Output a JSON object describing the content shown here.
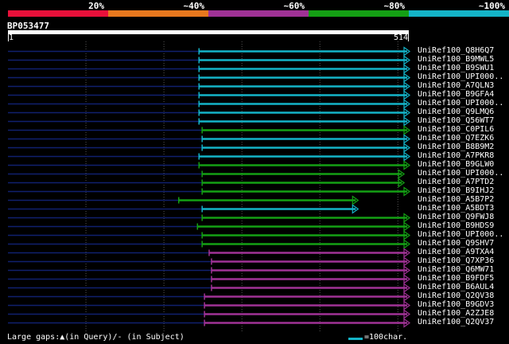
{
  "query": {
    "id": "BP053477",
    "start_label": "1",
    "end_label": "514",
    "length": 514
  },
  "identity_legend": [
    {
      "label": "20%",
      "color": "#e8103a"
    },
    {
      "label": "~40%",
      "color": "#e8781e"
    },
    {
      "label": "~60%",
      "color": "#a03296"
    },
    {
      "label": "~80%",
      "color": "#14a014"
    },
    {
      "label": "~100%",
      "color": "#14b4c8"
    }
  ],
  "hits": [
    {
      "label": "UniRef100_Q8H6Q7",
      "start": 245,
      "end": 514,
      "color": "#14b4c8"
    },
    {
      "label": "UniRef100_B9MWL5",
      "start": 245,
      "end": 514,
      "color": "#14b4c8"
    },
    {
      "label": "UniRef100_B9SWU1",
      "start": 245,
      "end": 514,
      "color": "#14b4c8"
    },
    {
      "label": "UniRef100_UPI000..",
      "start": 245,
      "end": 514,
      "color": "#14b4c8"
    },
    {
      "label": "UniRef100_A7QLN3",
      "start": 245,
      "end": 514,
      "color": "#14b4c8"
    },
    {
      "label": "UniRef100_B9GFA4",
      "start": 245,
      "end": 514,
      "color": "#14b4c8"
    },
    {
      "label": "UniRef100_UPI000..",
      "start": 245,
      "end": 514,
      "color": "#14b4c8"
    },
    {
      "label": "UniRef100_Q9LMQ6",
      "start": 245,
      "end": 514,
      "color": "#14b4c8"
    },
    {
      "label": "UniRef100_Q56WT7",
      "start": 245,
      "end": 514,
      "color": "#14b4c8"
    },
    {
      "label": "UniRef100_C0PIL6",
      "start": 249,
      "end": 514,
      "color": "#14a014"
    },
    {
      "label": "UniRef100_Q7EZK6",
      "start": 249,
      "end": 514,
      "color": "#14b4c8"
    },
    {
      "label": "UniRef100_B8B9M2",
      "start": 249,
      "end": 514,
      "color": "#14b4c8"
    },
    {
      "label": "UniRef100_A7PKR8",
      "start": 245,
      "end": 514,
      "color": "#14b4c8"
    },
    {
      "label": "UniRef100_B9GLW0",
      "start": 245,
      "end": 514,
      "color": "#14a014"
    },
    {
      "label": "UniRef100_UPI000..",
      "start": 249,
      "end": 507,
      "color": "#14a014"
    },
    {
      "label": "UniRef100_A7PTD2",
      "start": 249,
      "end": 507,
      "color": "#14a014"
    },
    {
      "label": "UniRef100_B9IHJ2",
      "start": 249,
      "end": 514,
      "color": "#14a014"
    },
    {
      "label": "UniRef100_A5B7P2",
      "start": 219,
      "end": 448,
      "color": "#14a014"
    },
    {
      "label": "UniRef100_A5BDT3",
      "start": 249,
      "end": 448,
      "color": "#14b4c8"
    },
    {
      "label": "UniRef100_Q9FWJ8",
      "start": 249,
      "end": 514,
      "color": "#14a014"
    },
    {
      "label": "UniRef100_B9HDS9",
      "start": 243,
      "end": 514,
      "color": "#14a014"
    },
    {
      "label": "UniRef100_UPI000..",
      "start": 249,
      "end": 514,
      "color": "#14a014"
    },
    {
      "label": "UniRef100_Q9SHV7",
      "start": 249,
      "end": 514,
      "color": "#14a014"
    },
    {
      "label": "UniRef100_A9TXA4",
      "start": 258,
      "end": 514,
      "color": "#a03296"
    },
    {
      "label": "UniRef100_Q7XP36",
      "start": 261,
      "end": 514,
      "color": "#a03296"
    },
    {
      "label": "UniRef100_Q6MW71",
      "start": 261,
      "end": 514,
      "color": "#a03296"
    },
    {
      "label": "UniRef100_B9FDF5",
      "start": 261,
      "end": 514,
      "color": "#a03296"
    },
    {
      "label": "UniRef100_B6AUL4",
      "start": 261,
      "end": 514,
      "color": "#a03296"
    },
    {
      "label": "UniRef100_Q2QV38",
      "start": 252,
      "end": 514,
      "color": "#a03296"
    },
    {
      "label": "UniRef100_B9GDV3",
      "start": 252,
      "end": 514,
      "color": "#a03296"
    },
    {
      "label": "UniRef100_A2ZJE8",
      "start": 252,
      "end": 514,
      "color": "#a03296"
    },
    {
      "label": "UniRef100_Q2QV37",
      "start": 252,
      "end": 514,
      "color": "#a03296"
    }
  ],
  "footer": {
    "gaps_text": "Large gaps:▲(in Query)/- (in Subject)",
    "scale_text": "=100char.",
    "scale_units": 100,
    "scale_color": "#14b4c8"
  }
}
